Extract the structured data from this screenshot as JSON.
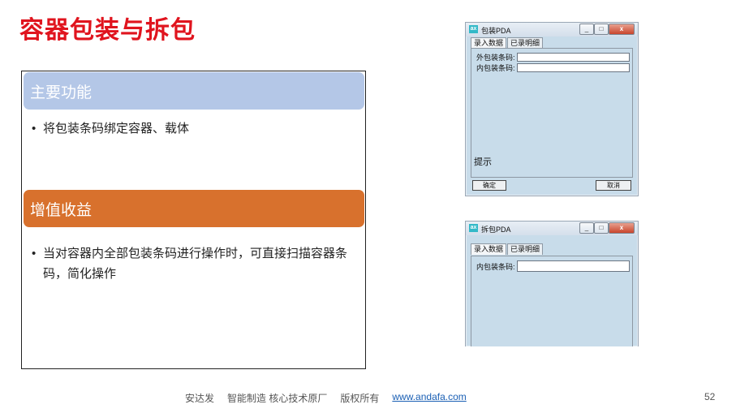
{
  "slide": {
    "title": "容器包装与拆包",
    "section1": {
      "heading": "主要功能",
      "bullets": [
        "将包装条码绑定容器、载体"
      ]
    },
    "section2": {
      "heading": "增值收益",
      "bullets": [
        "当对容器内全部包装条码进行操作时，可直接扫描容器条码，简化操作"
      ]
    }
  },
  "window1": {
    "app_icon_text": "ax",
    "title": "包装PDA",
    "controls": {
      "minimize": "_",
      "maximize": "□",
      "close": "x"
    },
    "tabs": [
      "录入数据",
      "已录明细"
    ],
    "fields": [
      {
        "label": "外包装条码:",
        "value": ""
      },
      {
        "label": "内包装条码:",
        "value": ""
      }
    ],
    "hint_label": "提示",
    "buttons": {
      "confirm": "确定",
      "cancel": "取消"
    }
  },
  "window2": {
    "app_icon_text": "ax",
    "title": "拆包PDA",
    "controls": {
      "minimize": "_",
      "maximize": "□",
      "close": "x"
    },
    "tabs": [
      "录入数据",
      "已录明细"
    ],
    "fields": [
      {
        "label": "内包装条码:",
        "value": ""
      }
    ]
  },
  "footer": {
    "company": "安达发",
    "slogan": "智能制造 核心技术原厂",
    "rights": "版权所有",
    "website": "www.andafa.com",
    "page_number": "52"
  }
}
